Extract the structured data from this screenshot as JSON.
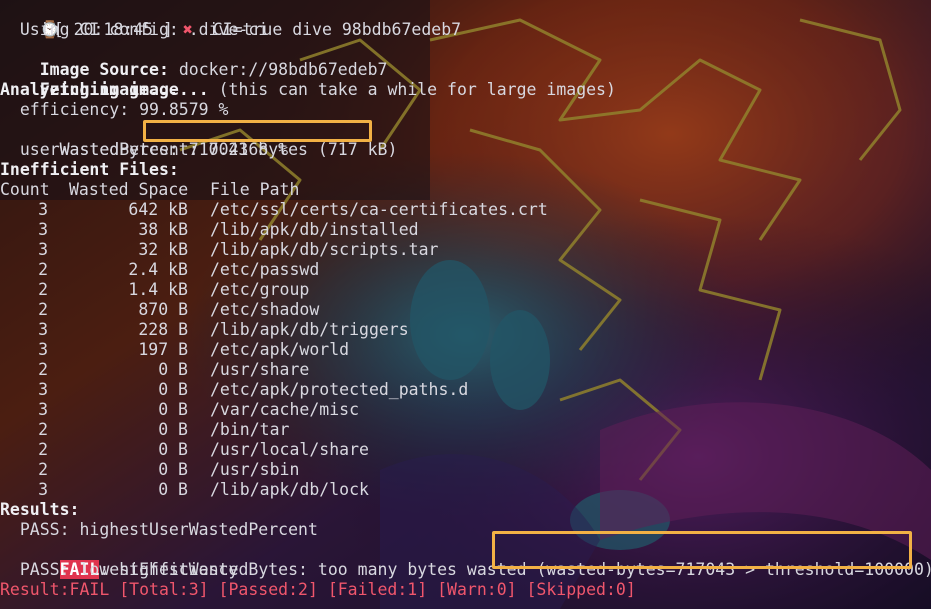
{
  "prompt": {
    "clock_glyph": "⌚",
    "time_segment": "[ 20:18:45 ]",
    "status_glyph": "✖",
    "command": "CI=true dive 98bdb67edeb7"
  },
  "intro": {
    "ci_config": "  Using CI config: .dive-ci",
    "image_source_label": "Image Source:",
    "image_source_value": " docker://98bdb67edeb7",
    "fetching_label": "Fetching image...",
    "fetching_note": " (this can take a while for large images)",
    "analyzing_label": "Analyzing image..."
  },
  "metrics": {
    "efficiency": "  efficiency: 99.8579 %",
    "wasted_bytes_label": "  wastedBytes: ",
    "wasted_bytes_value": "717043 bytes (717 kB)",
    "user_wasted_percent": "  userWastedPercent: 0.2168 %"
  },
  "inefficient": {
    "heading": "Inefficient Files:",
    "columns": {
      "count": "Count",
      "wasted_space": "Wasted Space",
      "file_path": "File Path"
    },
    "rows": [
      {
        "count": "3",
        "wasted": "642 kB",
        "path": "/etc/ssl/certs/ca-certificates.crt"
      },
      {
        "count": "3",
        "wasted": "38 kB",
        "path": "/lib/apk/db/installed"
      },
      {
        "count": "3",
        "wasted": "32 kB",
        "path": "/lib/apk/db/scripts.tar"
      },
      {
        "count": "2",
        "wasted": "2.4 kB",
        "path": "/etc/passwd"
      },
      {
        "count": "2",
        "wasted": "1.4 kB",
        "path": "/etc/group"
      },
      {
        "count": "2",
        "wasted": "870 B",
        "path": "/etc/shadow"
      },
      {
        "count": "3",
        "wasted": "228 B",
        "path": "/lib/apk/db/triggers"
      },
      {
        "count": "3",
        "wasted": "197 B",
        "path": "/etc/apk/world"
      },
      {
        "count": "2",
        "wasted": "0 B",
        "path": "/usr/share"
      },
      {
        "count": "3",
        "wasted": "0 B",
        "path": "/etc/apk/protected_paths.d"
      },
      {
        "count": "3",
        "wasted": "0 B",
        "path": "/var/cache/misc"
      },
      {
        "count": "2",
        "wasted": "0 B",
        "path": "/bin/tar"
      },
      {
        "count": "2",
        "wasted": "0 B",
        "path": "/usr/local/share"
      },
      {
        "count": "2",
        "wasted": "0 B",
        "path": "/usr/sbin"
      },
      {
        "count": "3",
        "wasted": "0 B",
        "path": "/lib/apk/db/lock"
      }
    ]
  },
  "results": {
    "heading": "Results:",
    "pass_1": "  PASS: highestUserWastedPercent",
    "fail_badge": "FAIL",
    "fail_message": ": highestWastedBytes: too many bytes wasted ",
    "fail_detail": "(wasted-bytes=717043 > threshold=100000)",
    "pass_2": "  PASS: lowestEfficiency",
    "summary": "Result:FAIL [Total:3] [Passed:2] [Failed:1] [Warn:0] [Skipped:0]"
  },
  "colors": {
    "highlight_box": "#f2b145",
    "fail_red": "#f0566c",
    "fail_badge_bg": "#e0344e",
    "terminal_text": "#d8d8e0"
  }
}
